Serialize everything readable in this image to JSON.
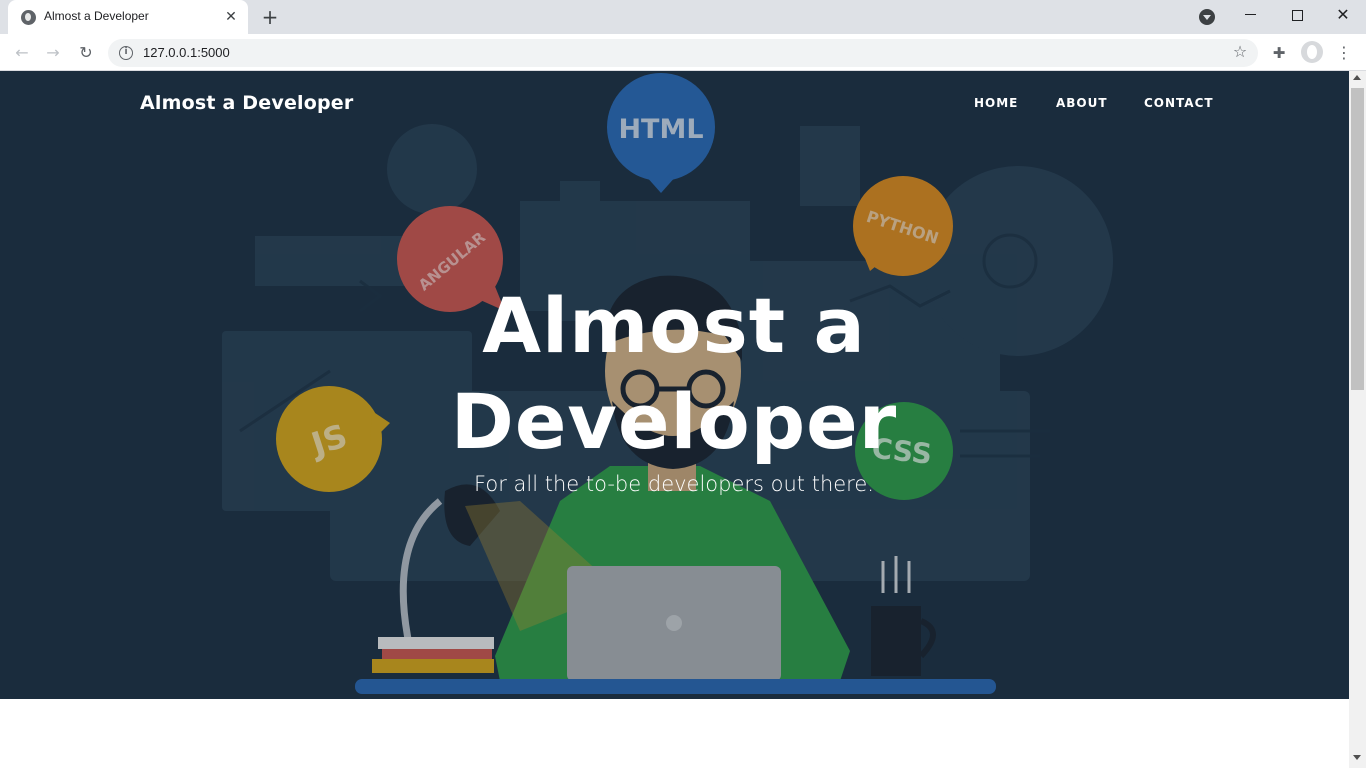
{
  "browser": {
    "tab_title": "Almost a Developer",
    "url": "127.0.0.1:5000",
    "icons": {
      "tab_favicon": "globe-icon",
      "tab_close": "close-icon",
      "new_tab": "plus-icon",
      "tab_search": "tab-search-icon",
      "minimize": "minimize-icon",
      "maximize": "restore-icon",
      "close": "close-icon",
      "back": "arrow-left-icon",
      "forward": "arrow-right-icon",
      "reload": "reload-icon",
      "site_info": "info-icon",
      "bookmark": "star-icon",
      "extensions": "puzzle-icon",
      "profile": "profile-icon",
      "menu": "kebab-menu-icon"
    }
  },
  "site": {
    "brand": "Almost a Developer",
    "nav": [
      {
        "label": "HOME"
      },
      {
        "label": "ABOUT"
      },
      {
        "label": "CONTACT"
      }
    ],
    "hero": {
      "heading_line1": "Almost a",
      "heading_line2": "Developer",
      "subheading": "For all the to-be developers out there.",
      "bubbles": [
        "HTML",
        "PYTHON",
        "ANGULAR",
        "JS",
        "CSS"
      ],
      "colors": {
        "background": "#1e3143",
        "html": "#2b6ab4",
        "python": "#d98a1e",
        "angular": "#c9574f",
        "js": "#d4a51a",
        "css": "#2f9a48",
        "shirt": "#2f9a48",
        "desk": "#2b67b0"
      }
    }
  }
}
